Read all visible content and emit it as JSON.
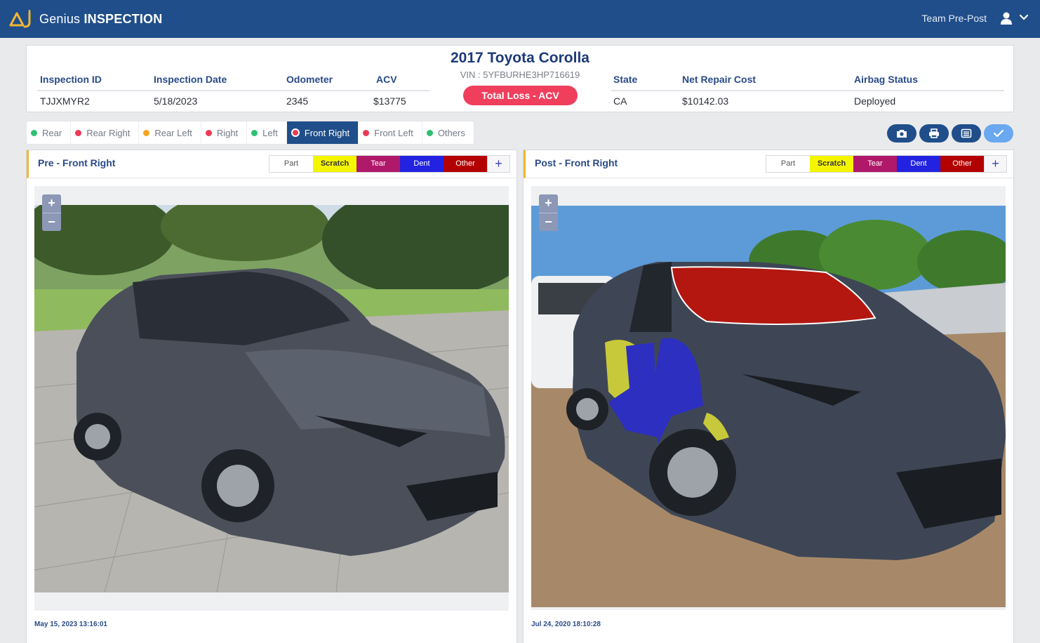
{
  "header": {
    "brand_prefix": "Genius",
    "brand_suffix": "INSPECTION",
    "team": "Team Pre-Post",
    "icons": [
      "logo-icon",
      "user-icon",
      "chevron-down-icon"
    ]
  },
  "summary": {
    "title": "2017 Toyota Corolla",
    "vin": "VIN : 5YFBURHE3HP716619",
    "status_button": "Total Loss - ACV",
    "fields": [
      {
        "label": "Inspection ID",
        "value": "TJJXMYR2"
      },
      {
        "label": "Inspection Date",
        "value": "5/18/2023"
      },
      {
        "label": "Odometer",
        "value": "2345"
      },
      {
        "label": "ACV",
        "value": "$13775"
      },
      {
        "label": "State",
        "value": "CA"
      },
      {
        "label": "Net Repair Cost",
        "value": "$10142.03"
      },
      {
        "label": "Airbag Status",
        "value": "Deployed"
      }
    ]
  },
  "tabs": [
    {
      "label": "Rear",
      "dot": "#2fbf71"
    },
    {
      "label": "Rear Right",
      "dot": "#ee3a55"
    },
    {
      "label": "Rear Left",
      "dot": "#f5a623"
    },
    {
      "label": "Right",
      "dot": "#ee3a55"
    },
    {
      "label": "Left",
      "dot": "#2fbf71"
    },
    {
      "label": "Front Right",
      "dot": "#ee3a55",
      "active": true
    },
    {
      "label": "Front Left",
      "dot": "#ee3a55"
    },
    {
      "label": "Others",
      "dot": "#2fbf71"
    }
  ],
  "actions": [
    "camera-icon",
    "print-icon",
    "list-icon",
    "check-icon"
  ],
  "legend": {
    "part": "Part",
    "scratch": "Scratch",
    "tear": "Tear",
    "dent": "Dent",
    "other": "Other",
    "add": "+"
  },
  "zoom": {
    "in": "+",
    "out": "−"
  },
  "pre": {
    "title": "Pre - Front Right",
    "timestamp": "May 15, 2023 13:16:01"
  },
  "post": {
    "title": "Post - Front Right",
    "timestamp": "Jul 24, 2020 18:10:28"
  },
  "colors": {
    "header_bg": "#1f4e8a",
    "accent_yellow": "#f2b632",
    "status_red": "#ef3f5d",
    "scratch": "#f5f500",
    "tear": "#b0186a",
    "dent": "#2222e0",
    "other": "#b30000"
  }
}
